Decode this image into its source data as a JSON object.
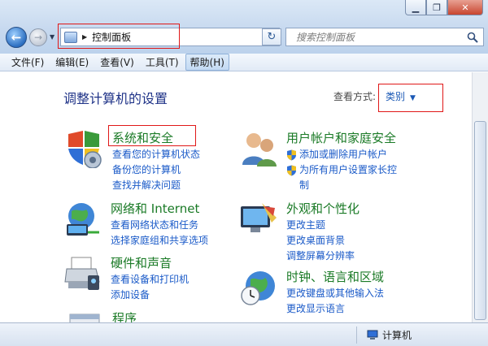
{
  "window": {
    "controls": [
      "minimize-icon",
      "restore-icon",
      "close-icon"
    ]
  },
  "address": {
    "crumb": "控制面板"
  },
  "search": {
    "placeholder": "搜索控制面板"
  },
  "menu": {
    "items": [
      "文件(F)",
      "编辑(E)",
      "查看(V)",
      "工具(T)",
      "帮助(H)"
    ],
    "active_index": 4
  },
  "content": {
    "heading": "调整计算机的设置",
    "view_by_label": "查看方式:",
    "view_by_value": "类别"
  },
  "categories": [
    {
      "title": "系统和安全",
      "icon": "shield-system-icon",
      "links": [
        "查看您的计算机状态",
        "备份您的计算机",
        "查找并解决问题"
      ]
    },
    {
      "title": "网络和 Internet",
      "icon": "network-icon",
      "links": [
        "查看网络状态和任务",
        "选择家庭组和共享选项"
      ]
    },
    {
      "title": "硬件和声音",
      "icon": "printer-icon",
      "links": [
        "查看设备和打印机",
        "添加设备"
      ]
    },
    {
      "title": "程序",
      "icon": "programs-icon",
      "links": []
    },
    {
      "title": "用户帐户和家庭安全",
      "icon": "users-icon",
      "links": [
        "添加或删除用户帐户",
        "为所有用户设置家长控制"
      ],
      "shield_links": [
        true,
        true
      ]
    },
    {
      "title": "外观和个性化",
      "icon": "monitor-appearance-icon",
      "links": [
        "更改主题",
        "更改桌面背景",
        "调整屏幕分辨率"
      ]
    },
    {
      "title": "时钟、语言和区域",
      "icon": "clock-globe-icon",
      "links": [
        "更改键盘或其他输入法",
        "更改显示语言"
      ]
    }
  ],
  "status": {
    "location": "计算机"
  },
  "colors": {
    "category_title": "#1a7a26",
    "link": "#1a5ac8",
    "heading": "#1e3287",
    "highlight_box": "#e01818"
  }
}
